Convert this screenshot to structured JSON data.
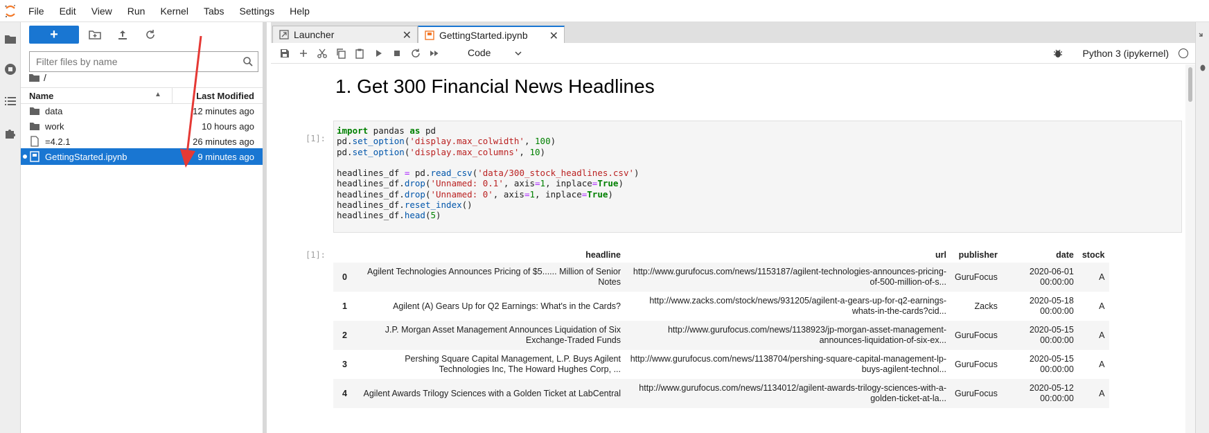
{
  "menu": [
    "File",
    "Edit",
    "View",
    "Run",
    "Kernel",
    "Tabs",
    "Settings",
    "Help"
  ],
  "filebrowser": {
    "new_label": "+",
    "filter_placeholder": "Filter files by name",
    "breadcrumb": "/",
    "col_name": "Name",
    "col_modified": "Last Modified",
    "files": [
      {
        "name": "data",
        "modified": "12 minutes ago",
        "icon": "folder-icon"
      },
      {
        "name": "work",
        "modified": "10 hours ago",
        "icon": "folder-icon"
      },
      {
        "name": "=4.2.1",
        "modified": "26 minutes ago",
        "icon": "file-icon"
      },
      {
        "name": "GettingStarted.ipynb",
        "modified": "9 minutes ago",
        "icon": "notebook-icon",
        "selected": true
      }
    ]
  },
  "tabs": [
    {
      "label": "Launcher",
      "icon": "launcher-icon"
    },
    {
      "label": "GettingStarted.ipynb",
      "icon": "notebook-icon",
      "active": true
    }
  ],
  "notebook": {
    "cell_type": "Code",
    "kernel": "Python 3 (ipykernel)",
    "heading": "1. Get 300 Financial News Headlines",
    "prompt_in": "[1]:",
    "prompt_out": "[1]:",
    "code_lines": [
      "import pandas as pd",
      "pd.set_option('display.max_colwidth', 100)",
      "pd.set_option('display.max_columns', 10)",
      "",
      "headlines_df = pd.read_csv('data/300_stock_headlines.csv')",
      "headlines_df.drop('Unnamed: 0.1', axis=1, inplace=True)",
      "headlines_df.drop('Unnamed: 0', axis=1, inplace=True)",
      "headlines_df.reset_index()",
      "headlines_df.head(5)"
    ],
    "table": {
      "columns": [
        "",
        "headline",
        "url",
        "publisher",
        "date",
        "stock"
      ],
      "rows": [
        {
          "idx": "0",
          "headline": "Agilent Technologies Announces Pricing of $5...... Million of Senior Notes",
          "url": "http://www.gurufocus.com/news/1153187/agilent-technologies-announces-pricing-of-500-million-of-s...",
          "publisher": "GuruFocus",
          "date": "2020-06-01 00:00:00",
          "stock": "A"
        },
        {
          "idx": "1",
          "headline": "Agilent (A) Gears Up for Q2 Earnings: What's in the Cards?",
          "url": "http://www.zacks.com/stock/news/931205/agilent-a-gears-up-for-q2-earnings-whats-in-the-cards?cid...",
          "publisher": "Zacks",
          "date": "2020-05-18 00:00:00",
          "stock": "A"
        },
        {
          "idx": "2",
          "headline": "J.P. Morgan Asset Management Announces Liquidation of Six Exchange-Traded Funds",
          "url": "http://www.gurufocus.com/news/1138923/jp-morgan-asset-management-announces-liquidation-of-six-ex...",
          "publisher": "GuruFocus",
          "date": "2020-05-15 00:00:00",
          "stock": "A"
        },
        {
          "idx": "3",
          "headline": "Pershing Square Capital Management, L.P. Buys Agilent Technologies Inc, The Howard Hughes Corp, ...",
          "url": "http://www.gurufocus.com/news/1138704/pershing-square-capital-management-lp-buys-agilent-technol...",
          "publisher": "GuruFocus",
          "date": "2020-05-15 00:00:00",
          "stock": "A"
        },
        {
          "idx": "4",
          "headline": "Agilent Awards Trilogy Sciences with a Golden Ticket at LabCentral",
          "url": "http://www.gurufocus.com/news/1134012/agilent-awards-trilogy-sciences-with-a-golden-ticket-at-la...",
          "publisher": "GuruFocus",
          "date": "2020-05-12 00:00:00",
          "stock": "A"
        }
      ]
    }
  },
  "colors": {
    "accent": "#1976d2",
    "annotation_arrow": "#e53935",
    "jupyter_orange": "#f37726"
  }
}
